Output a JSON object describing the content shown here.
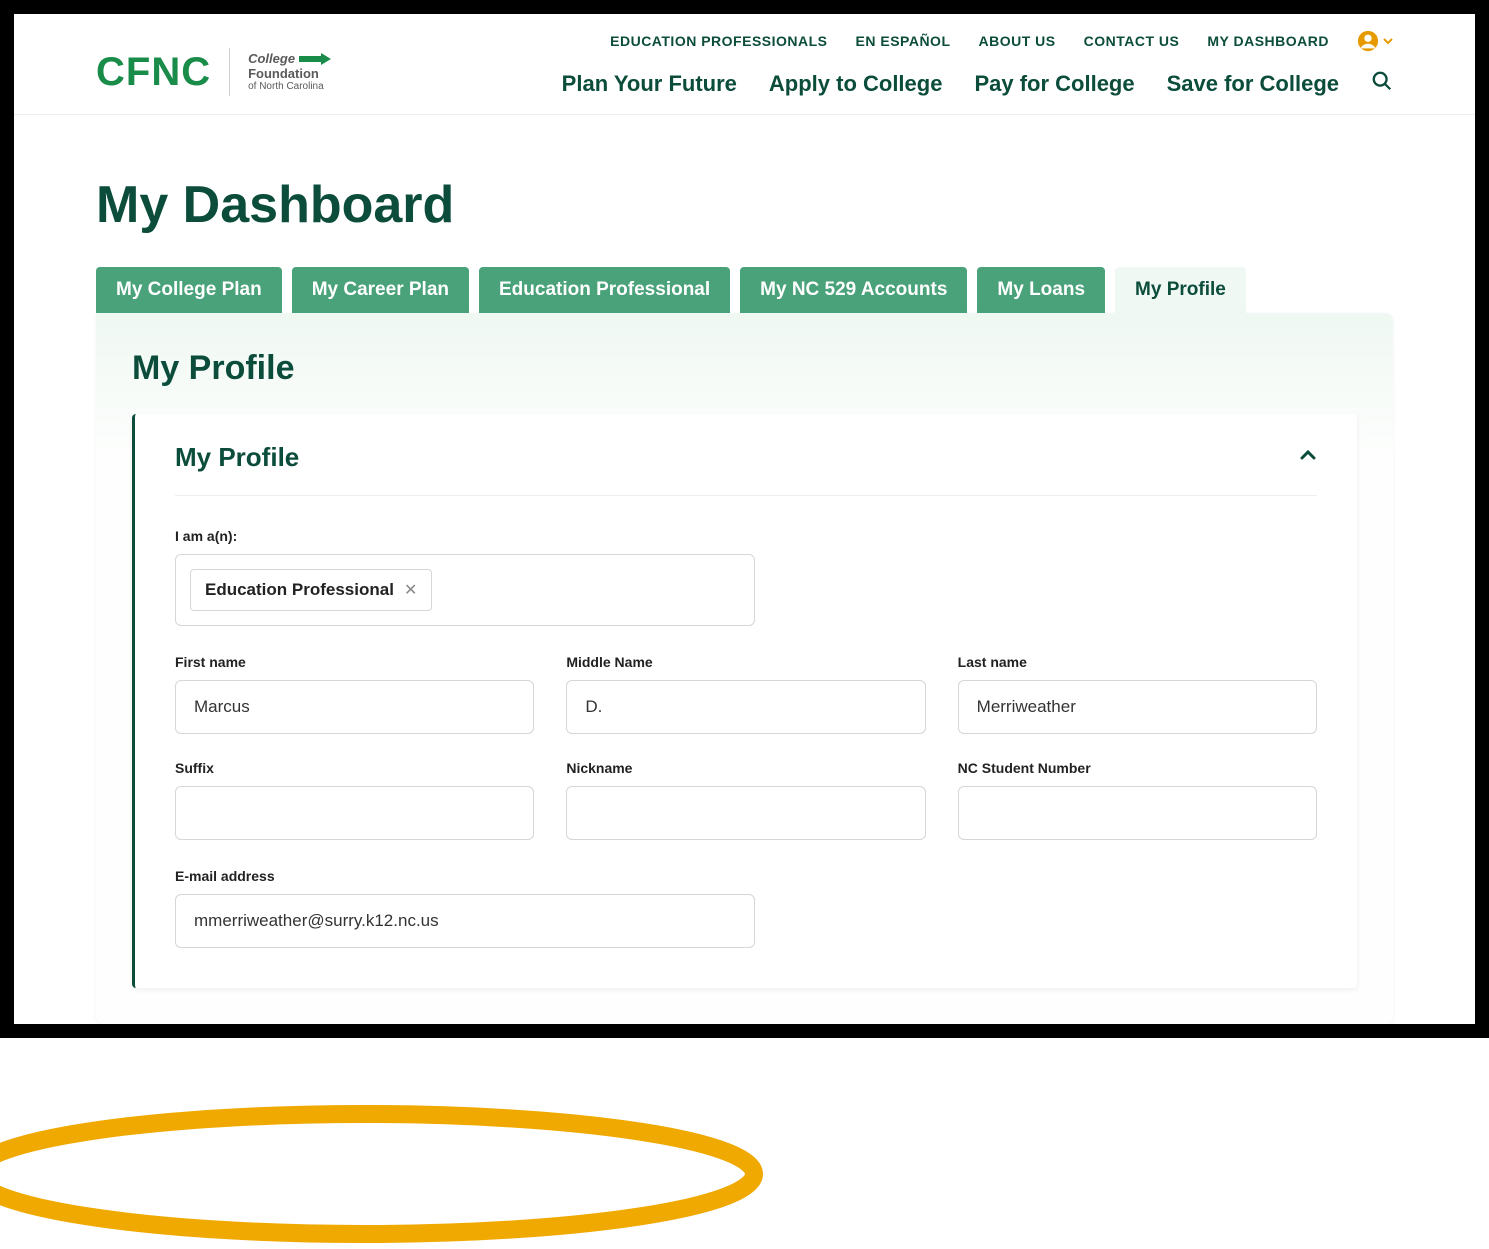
{
  "brand": {
    "logo": "CFNC",
    "sub1": "College",
    "sub2": "Foundation",
    "sub3": "of North Carolina"
  },
  "utilnav": {
    "edpro": "EDUCATION PROFESSIONALS",
    "espanol": "EN ESPAÑOL",
    "about": "ABOUT US",
    "contact": "CONTACT US",
    "dashboard": "MY DASHBOARD"
  },
  "mainnav": {
    "plan": "Plan Your Future",
    "apply": "Apply to College",
    "pay": "Pay for College",
    "save": "Save for College"
  },
  "page": {
    "title": "My Dashboard"
  },
  "tabs": {
    "collegeplan": "My College Plan",
    "careerplan": "My Career Plan",
    "edpro": "Education Professional",
    "nc529": "My NC 529 Accounts",
    "loans": "My Loans",
    "profile": "My Profile"
  },
  "panel": {
    "heading": "My Profile"
  },
  "card": {
    "heading": "My Profile"
  },
  "form": {
    "iam_label": "I am a(n):",
    "iam_chip": "Education Professional",
    "first_label": "First name",
    "first_value": "Marcus",
    "middle_label": "Middle Name",
    "middle_value": "D.",
    "last_label": "Last name",
    "last_value": "Merriweather",
    "suffix_label": "Suffix",
    "suffix_value": "",
    "nickname_label": "Nickname",
    "nickname_value": "",
    "ncsn_label": "NC Student Number",
    "ncsn_value": "",
    "email_label": "E-mail address",
    "email_value": "mmerriweather@surry.k12.nc.us"
  }
}
